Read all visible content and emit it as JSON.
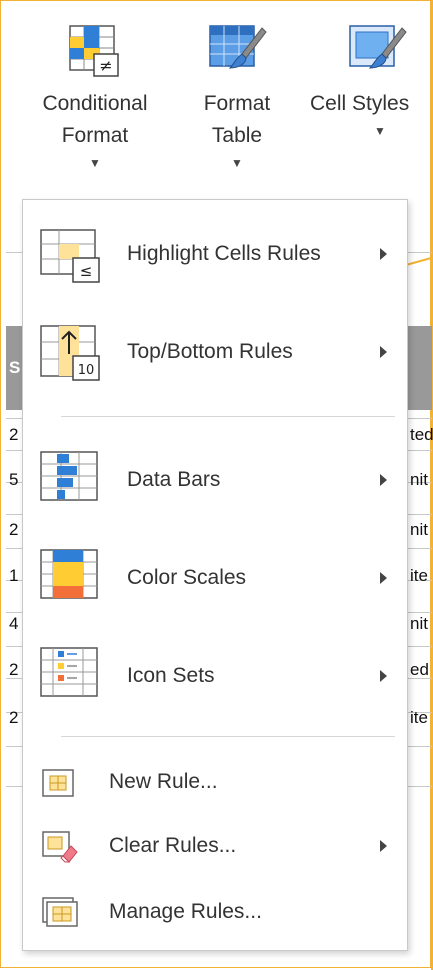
{
  "ribbon": {
    "conditional_format": {
      "line1": "Conditional",
      "line2": "Format"
    },
    "format_table": {
      "line1": "Format",
      "line2": "Table"
    },
    "cell_styles": {
      "line1": "Cell Styles"
    }
  },
  "sheet": {
    "header_fragment": "S",
    "rows_left": [
      "2",
      "5",
      "2",
      "1",
      "4",
      "2",
      "2"
    ],
    "rows_right": [
      "ted",
      "nit",
      "nit",
      "ite",
      "nit",
      "ed",
      "ite"
    ]
  },
  "menu": {
    "highlight": "Highlight Cells Rules",
    "topbottom": "Top/Bottom Rules",
    "databars": "Data Bars",
    "colorscales": "Color Scales",
    "iconsets": "Icon Sets",
    "newrule": "New Rule...",
    "clearrules": "Clear Rules...",
    "managerules": "Manage Rules..."
  },
  "icon_glyphs": {
    "not_equal": "≠",
    "less_equal": "≤",
    "top_ten": "10"
  },
  "colors": {
    "accent_border": "#f2b233",
    "icon_blue": "#2f7fd6",
    "icon_yellow": "#ffcc33",
    "icon_orange": "#f26f3a"
  }
}
